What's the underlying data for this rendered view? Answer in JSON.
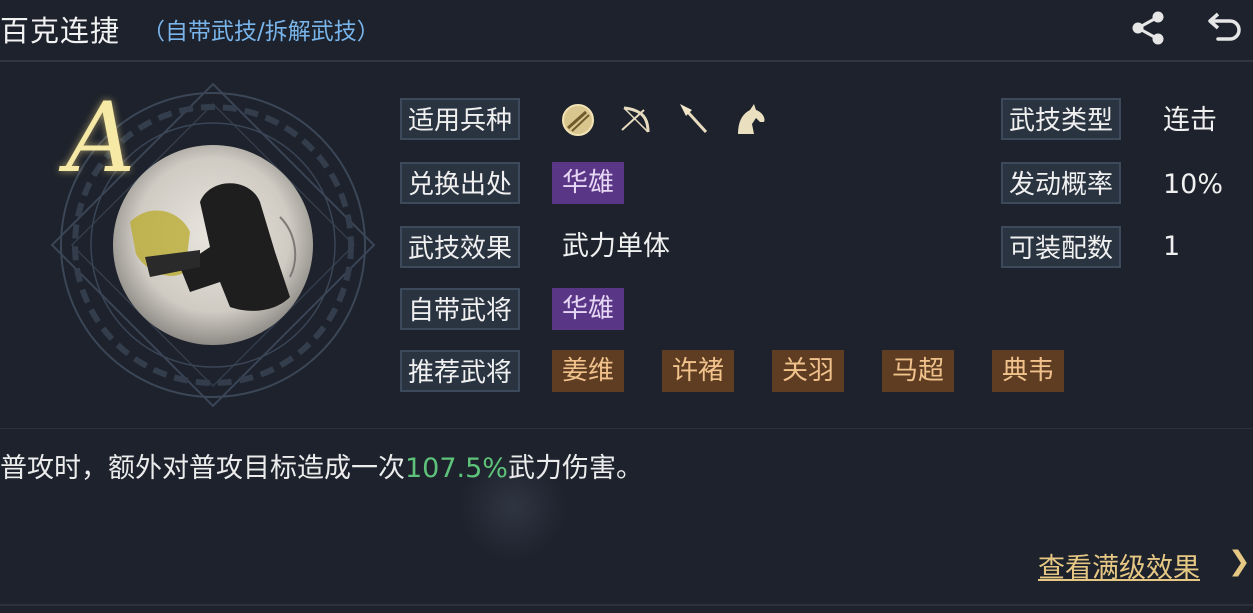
{
  "header": {
    "title": "百克连捷",
    "subtitle": "（自带武技/拆解武技）",
    "share_icon": "share-icon",
    "back_icon": "back-icon"
  },
  "skill": {
    "grade": "A",
    "troop_label": "适用兵种",
    "troop_icons": [
      "shield-icon",
      "bow-icon",
      "spear-icon",
      "horse-icon"
    ],
    "source_label": "兑换出处",
    "source_value": "华雄",
    "effect_label": "武技效果",
    "effect_value": "武力单体",
    "own_general_label": "自带武将",
    "own_general_value": "华雄",
    "recommend_label": "推荐武将",
    "recommend_values": [
      "姜维",
      "许褚",
      "关羽",
      "马超",
      "典韦"
    ],
    "type_label": "武技类型",
    "type_value": "连击",
    "rate_label": "发动概率",
    "rate_value": "10%",
    "equip_label": "可装配数",
    "equip_value": "1"
  },
  "description": {
    "prefix": "普攻时，额外对普攻目标造成一次",
    "highlight": "107.5%",
    "suffix": "武力伤害。"
  },
  "footer": {
    "link_label": "查看满级效果",
    "arrow": "❯"
  },
  "colors": {
    "background": "#1d222c",
    "accent_blue": "#79b4ea",
    "highlight_green": "#5ec37a",
    "link_gold": "#e6c884",
    "tag_purple": "#5a3686",
    "tag_orange": "#5e3d23"
  }
}
